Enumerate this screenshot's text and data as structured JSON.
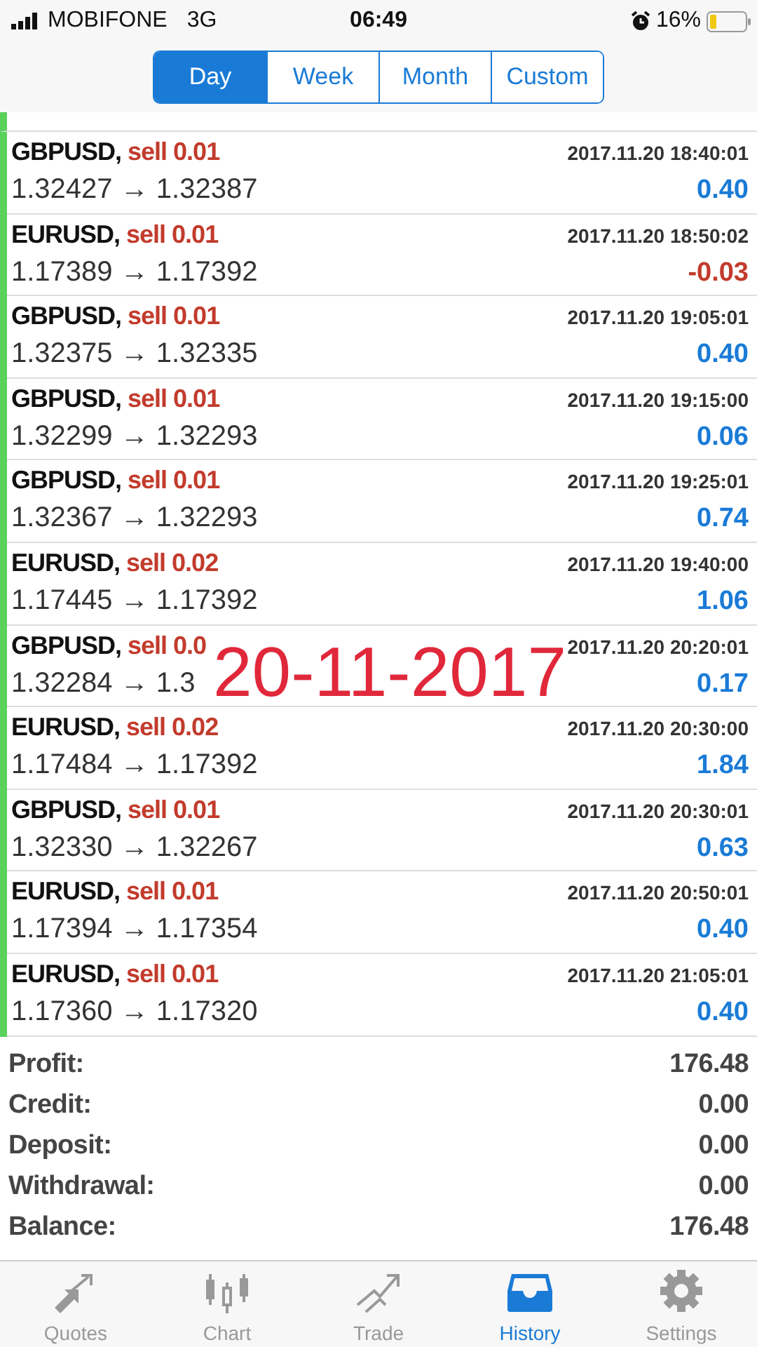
{
  "status_bar": {
    "carrier": "MOBIFONE",
    "network": "3G",
    "time": "06:49",
    "battery": "16%"
  },
  "period_tabs": [
    {
      "label": "Day",
      "selected": true
    },
    {
      "label": "Week",
      "selected": false
    },
    {
      "label": "Month",
      "selected": false
    },
    {
      "label": "Custom",
      "selected": false
    }
  ],
  "deals": [
    {
      "symbol": "GBPUSD,",
      "action": "sell 0.01",
      "time": "2017.11.20 18:40:01",
      "prices": "1.32427 → 1.32387",
      "profit": "0.40",
      "loss": false
    },
    {
      "symbol": "EURUSD,",
      "action": "sell 0.01",
      "time": "2017.11.20 18:50:02",
      "prices": "1.17389 → 1.17392",
      "profit": "-0.03",
      "loss": true
    },
    {
      "symbol": "GBPUSD,",
      "action": "sell 0.01",
      "time": "2017.11.20 19:05:01",
      "prices": "1.32375 → 1.32335",
      "profit": "0.40",
      "loss": false
    },
    {
      "symbol": "GBPUSD,",
      "action": "sell 0.01",
      "time": "2017.11.20 19:15:00",
      "prices": "1.32299 → 1.32293",
      "profit": "0.06",
      "loss": false
    },
    {
      "symbol": "GBPUSD,",
      "action": "sell 0.01",
      "time": "2017.11.20 19:25:01",
      "prices": "1.32367 → 1.32293",
      "profit": "0.74",
      "loss": false
    },
    {
      "symbol": "EURUSD,",
      "action": "sell 0.02",
      "time": "2017.11.20 19:40:00",
      "prices": "1.17445 → 1.17392",
      "profit": "1.06",
      "loss": false
    },
    {
      "symbol": "GBPUSD,",
      "action": "sell 0.0",
      "time": "2017.11.20 20:20:01",
      "prices": "1.32284 → 1.3",
      "profit": "0.17",
      "loss": false
    },
    {
      "symbol": "EURUSD,",
      "action": "sell 0.02",
      "time": "2017.11.20 20:30:00",
      "prices": "1.17484 → 1.17392",
      "profit": "1.84",
      "loss": false
    },
    {
      "symbol": "GBPUSD,",
      "action": "sell 0.01",
      "time": "2017.11.20 20:30:01",
      "prices": "1.32330 → 1.32267",
      "profit": "0.63",
      "loss": false
    },
    {
      "symbol": "EURUSD,",
      "action": "sell 0.01",
      "time": "2017.11.20 20:50:01",
      "prices": "1.17394 → 1.17354",
      "profit": "0.40",
      "loss": false
    },
    {
      "symbol": "EURUSD,",
      "action": "sell 0.01",
      "time": "2017.11.20 21:05:01",
      "prices": "1.17360 → 1.17320",
      "profit": "0.40",
      "loss": false
    }
  ],
  "overlay_text": "20-11-2017",
  "summary": [
    {
      "label": "Profit:",
      "value": "176.48"
    },
    {
      "label": "Credit:",
      "value": "0.00"
    },
    {
      "label": "Deposit:",
      "value": "0.00"
    },
    {
      "label": "Withdrawal:",
      "value": "0.00"
    },
    {
      "label": "Balance:",
      "value": "176.48"
    }
  ],
  "tab_bar": [
    {
      "label": "Quotes",
      "kind": "quotes",
      "selected": false
    },
    {
      "label": "Chart",
      "kind": "chart",
      "selected": false
    },
    {
      "label": "Trade",
      "kind": "trade",
      "selected": false
    },
    {
      "label": "History",
      "kind": "history",
      "selected": true
    },
    {
      "label": "Settings",
      "kind": "settings",
      "selected": false
    }
  ]
}
